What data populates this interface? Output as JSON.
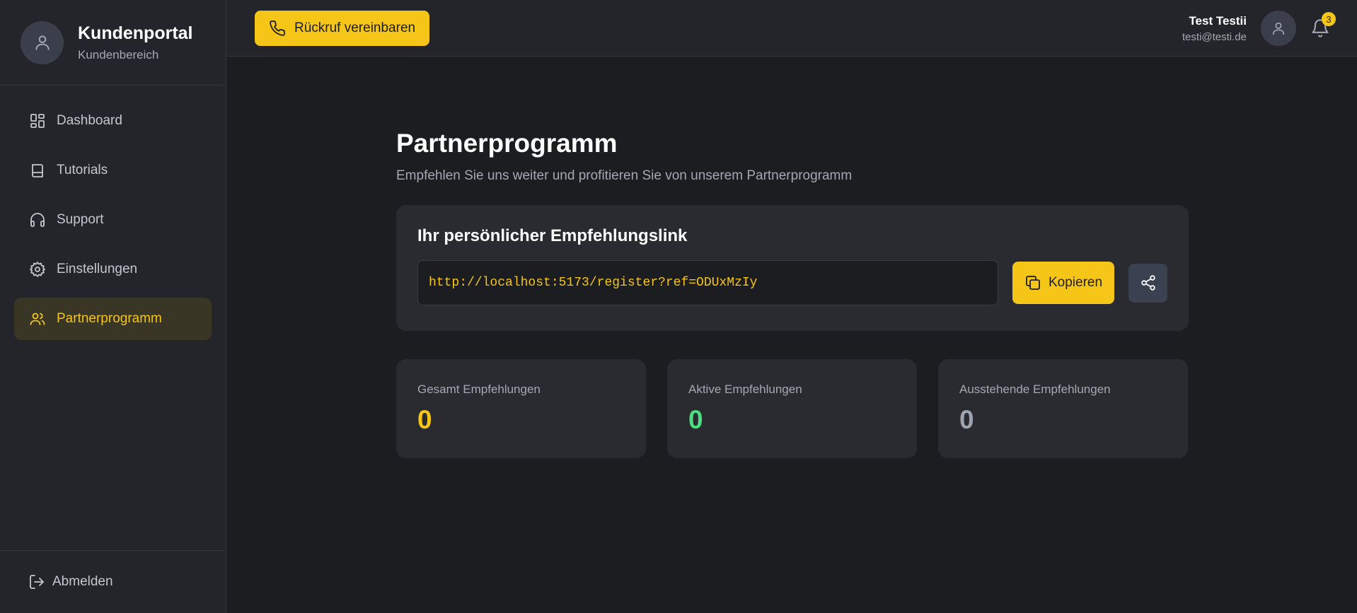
{
  "brand": {
    "title": "Kundenportal",
    "subtitle": "Kundenbereich"
  },
  "sidebar": {
    "items": [
      {
        "label": "Dashboard",
        "icon": "dashboard-icon",
        "active": false
      },
      {
        "label": "Tutorials",
        "icon": "book-icon",
        "active": false
      },
      {
        "label": "Support",
        "icon": "headphones-icon",
        "active": false
      },
      {
        "label": "Einstellungen",
        "icon": "gear-icon",
        "active": false
      },
      {
        "label": "Partnerprogramm",
        "icon": "users-icon",
        "active": true
      }
    ],
    "logout_label": "Abmelden"
  },
  "topbar": {
    "callback_label": "Rückruf vereinbaren",
    "user_name": "Test Testii",
    "user_email": "testi@testi.de",
    "notification_count": "3"
  },
  "main": {
    "title": "Partnerprogramm",
    "subtitle": "Empfehlen Sie uns weiter und profitieren Sie von unserem Partnerprogramm",
    "link_card": {
      "title": "Ihr persönlicher Empfehlungslink",
      "link_value": "http://localhost:5173/register?ref=ODUxMzIy",
      "copy_label": "Kopieren"
    },
    "stats": [
      {
        "label": "Gesamt Empfehlungen",
        "value": "0",
        "color": "#f5c518"
      },
      {
        "label": "Aktive Empfehlungen",
        "value": "0",
        "color": "#4ade80"
      },
      {
        "label": "Ausstehende Empfehlungen",
        "value": "0",
        "color": "#9ca3af"
      }
    ]
  },
  "colors": {
    "accent": "#f5c518",
    "background": "#1c1d21",
    "surface": "#2a2b30"
  }
}
